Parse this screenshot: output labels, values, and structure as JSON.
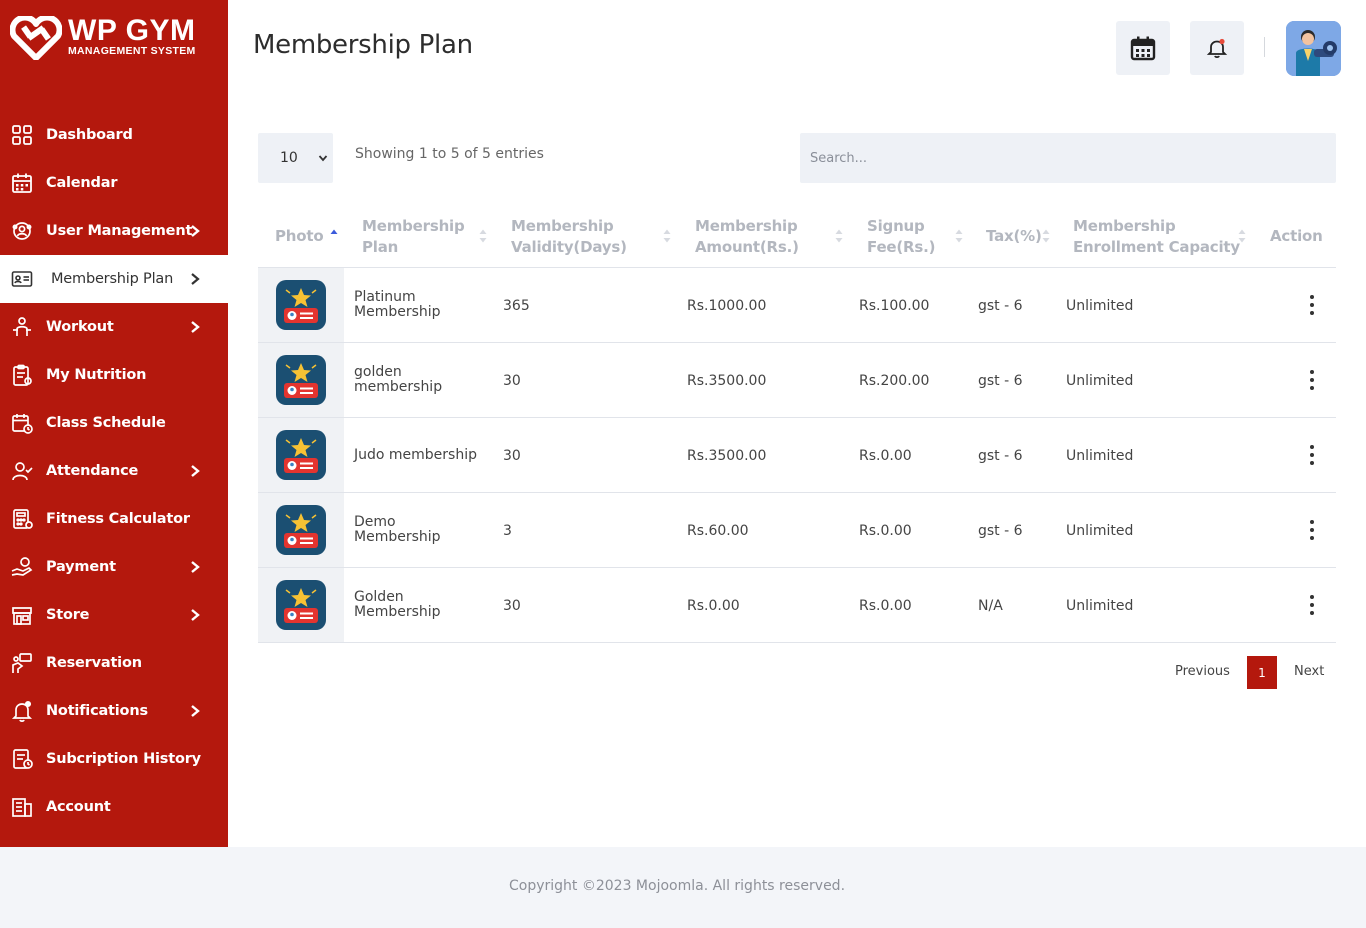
{
  "brand": {
    "title": "WP GYM",
    "subtitle": "MANAGEMENT SYSTEM"
  },
  "sidebar": {
    "items": [
      {
        "label": "Dashboard",
        "icon": "grid-icon"
      },
      {
        "label": "Calendar",
        "icon": "calendar-icon"
      },
      {
        "label": "User Management",
        "icon": "users-gear-icon",
        "has_submenu": true
      },
      {
        "label": "Membership Plan",
        "icon": "id-card-icon",
        "has_submenu": true,
        "active": true
      },
      {
        "label": "Workout",
        "icon": "dumbbell-user-icon",
        "has_submenu": true
      },
      {
        "label": "My Nutrition",
        "icon": "clipboard-icon"
      },
      {
        "label": "Class Schedule",
        "icon": "schedule-icon"
      },
      {
        "label": "Attendance",
        "icon": "user-check-icon",
        "has_submenu": true
      },
      {
        "label": "Fitness Calculator",
        "icon": "calculator-icon"
      },
      {
        "label": "Payment",
        "icon": "hand-coin-icon",
        "has_submenu": true
      },
      {
        "label": "Store",
        "icon": "store-icon",
        "has_submenu": true
      },
      {
        "label": "Reservation",
        "icon": "reservation-icon"
      },
      {
        "label": "Notifications",
        "icon": "bell-icon",
        "has_submenu": true
      },
      {
        "label": "Subcription History",
        "icon": "history-doc-icon"
      },
      {
        "label": "Account",
        "icon": "account-building-icon"
      }
    ]
  },
  "header": {
    "title": "Membership Plan"
  },
  "controls": {
    "page_length": "10",
    "entries_info": "Showing 1 to 5 of 5 entries",
    "search_placeholder": "Search..."
  },
  "table": {
    "headers": {
      "photo": "Photo",
      "plan_1": "Membership",
      "plan_2": "Plan",
      "validity_1": "Membership",
      "validity_2": "Validity(Days)",
      "amount_1": "Membership",
      "amount_2": "Amount(Rs.)",
      "fee_1": "Signup",
      "fee_2": "Fee(Rs.)",
      "tax": "Tax(%)",
      "capacity_1": "Membership",
      "capacity_2": "Enrollment Capacity",
      "action": "Action"
    },
    "rows": [
      {
        "plan_1": "Platinum",
        "plan_2": "Membership",
        "validity": "365",
        "amount": "Rs.1000.00",
        "fee": "Rs.100.00",
        "tax": "gst - 6",
        "capacity": "Unlimited"
      },
      {
        "plan_1": "golden",
        "plan_2": "membership",
        "validity": "30",
        "amount": "Rs.3500.00",
        "fee": "Rs.200.00",
        "tax": "gst - 6",
        "capacity": "Unlimited"
      },
      {
        "plan_1": "Judo membership",
        "plan_2": "",
        "validity": "30",
        "amount": "Rs.3500.00",
        "fee": "Rs.0.00",
        "tax": "gst - 6",
        "capacity": "Unlimited"
      },
      {
        "plan_1": "Demo",
        "plan_2": "Membership",
        "validity": "3",
        "amount": "Rs.60.00",
        "fee": "Rs.0.00",
        "tax": "gst - 6",
        "capacity": "Unlimited"
      },
      {
        "plan_1": "Golden",
        "plan_2": "Membership",
        "validity": "30",
        "amount": "Rs.0.00",
        "fee": "Rs.0.00",
        "tax": "N/A",
        "capacity": "Unlimited"
      }
    ]
  },
  "pagination": {
    "previous": "Previous",
    "current": "1",
    "next": "Next"
  },
  "footer": {
    "copyright": "Copyright ©2023 Mojoomla. All rights reserved."
  },
  "colors": {
    "brand_red": "#b4180d",
    "panel_bg": "#eef1f6",
    "footer_bg": "#f3f5f9",
    "icon_blue": "#1b4f72",
    "notification_dot": "#e74c3c"
  }
}
